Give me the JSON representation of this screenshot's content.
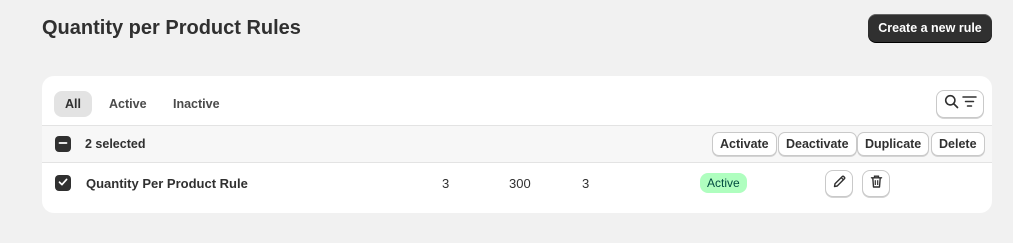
{
  "header": {
    "title": "Quantity per Product Rules",
    "create_button": "Create a new rule"
  },
  "tabs": [
    {
      "label": "All",
      "active": true
    },
    {
      "label": "Active",
      "active": false
    },
    {
      "label": "Inactive",
      "active": false
    }
  ],
  "toolbar": {
    "search_icon": "search-icon",
    "filter_icon": "filter-icon"
  },
  "bulk_actions": {
    "selected_text": "2 selected",
    "buttons": [
      "Activate",
      "Deactivate",
      "Duplicate",
      "Delete"
    ]
  },
  "rows": [
    {
      "checked": true,
      "name": "Quantity Per Product Rule",
      "col1": "3",
      "col2": "300",
      "col3": "3",
      "status": "Active"
    }
  ],
  "colors": {
    "primary": "#303030",
    "badge_success_bg": "#affebf",
    "badge_success_text": "#014b40"
  }
}
